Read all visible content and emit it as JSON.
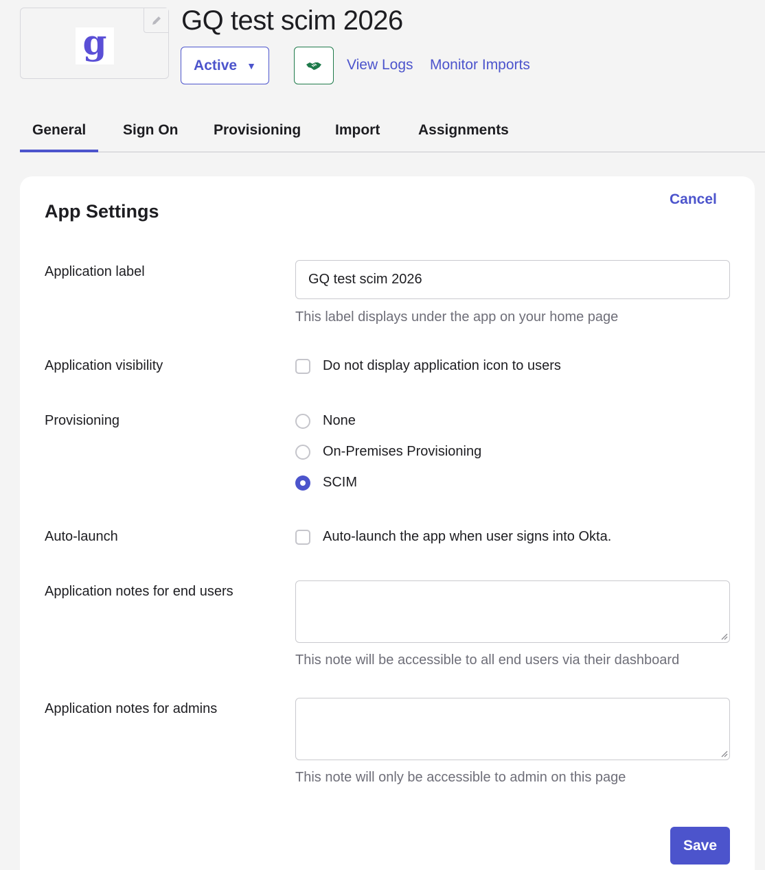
{
  "header": {
    "logo_letter": "g",
    "logo_color": "#5a4fd6",
    "title": "GQ test scim 2026",
    "status_label": "Active",
    "status_caret": "▼",
    "handshake_icon": "handshake-icon",
    "links": [
      "View Logs",
      "Monitor Imports"
    ]
  },
  "tabs": [
    {
      "label": "General",
      "active": true
    },
    {
      "label": "Sign On",
      "active": false
    },
    {
      "label": "Provisioning",
      "active": false
    },
    {
      "label": "Import",
      "active": false
    },
    {
      "label": "Assignments",
      "active": false
    }
  ],
  "settings": {
    "title": "App Settings",
    "cancel_label": "Cancel",
    "app_label": {
      "label": "Application label",
      "value": "GQ test scim 2026",
      "help": "This label displays under the app on your home page"
    },
    "visibility": {
      "label": "Application visibility",
      "option": "Do not display application icon to users",
      "checked": false
    },
    "provisioning": {
      "label": "Provisioning",
      "options": [
        "None",
        "On-Premises Provisioning",
        "SCIM"
      ],
      "selected": "SCIM"
    },
    "auto_launch": {
      "label": "Auto-launch",
      "option": "Auto-launch the app when user signs into Okta.",
      "checked": false
    },
    "notes_end_users": {
      "label": "Application notes for end users",
      "value": "",
      "help": "This note will be accessible to all end users via their dashboard"
    },
    "notes_admins": {
      "label": "Application notes for admins",
      "value": "",
      "help": "This note will only be accessible to admin on this page"
    },
    "save_label": "Save"
  },
  "colors": {
    "accent": "#4c54cc",
    "success_border": "#1e7a4a",
    "page_bg": "#f4f4f4"
  }
}
